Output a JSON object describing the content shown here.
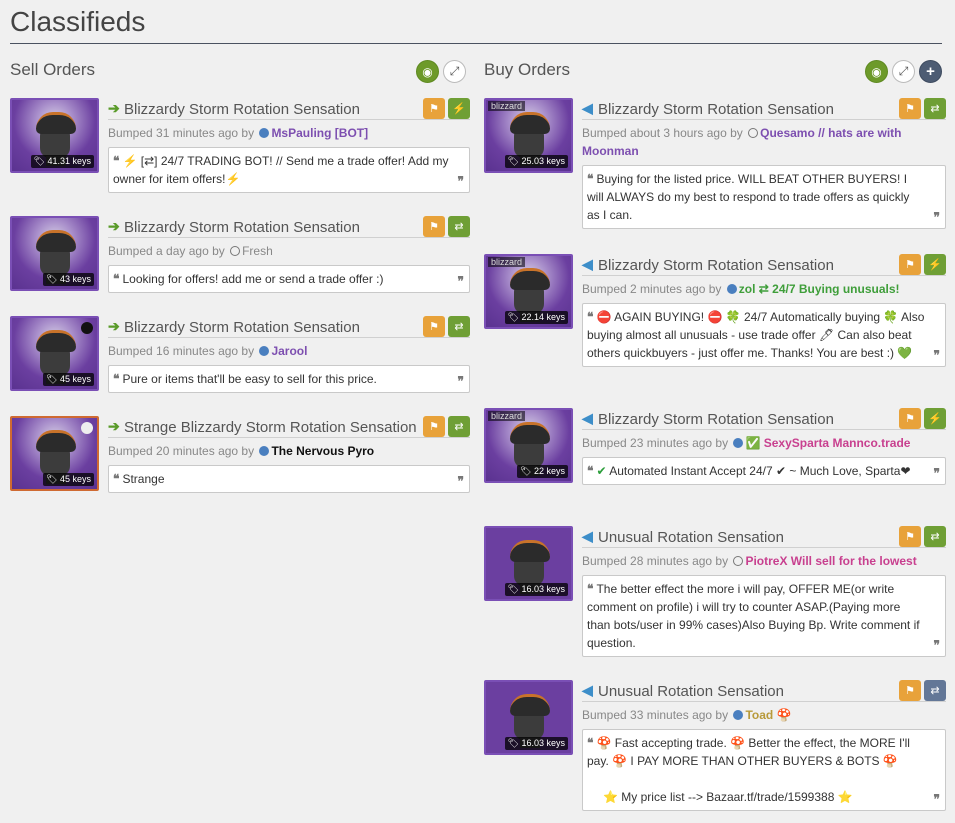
{
  "page": {
    "title": "Classifieds"
  },
  "sell": {
    "title": "Sell Orders",
    "listings": [
      {
        "name": "Blizzardy Storm Rotation Sensation",
        "price": "41.31 keys",
        "bump": "Bumped 31 minutes ago by",
        "user": "MsPauling [BOT]",
        "user_color": "#7d4fb0",
        "dot": "filled",
        "msg_a": "⚡",
        "msg_b": " [⇄] 24/7 TRADING BOT! // Send me a trade offer! Add my owner for item offers!",
        "msg_c": "⚡",
        "btn2": "⚡"
      },
      {
        "name": "Blizzardy Storm Rotation Sensation",
        "price": "43 keys",
        "bump": "Bumped a day ago by",
        "user": "Fresh",
        "user_color": "#888888",
        "dot": "ring",
        "msg_b": "Looking for offers! add me or send a trade offer :)",
        "btn2": "⇄"
      },
      {
        "name": "Blizzardy Storm Rotation Sensation",
        "price": "45 keys",
        "bump": "Bumped 16 minutes ago by",
        "user": "Jarool",
        "user_color": "#7d4fb0",
        "dot": "filled",
        "msg_b": "Pure or items that'll be easy to sell for this price.",
        "btn2": "⇄"
      },
      {
        "name": "Strange Blizzardy Storm Rotation Sensation",
        "price": "45 keys",
        "bump": "Bumped 20 minutes ago by",
        "user": "The Nervous Pyro",
        "user_color": "#111111",
        "dot": "filled",
        "msg_b": "Strange",
        "btn2": "⇄"
      }
    ]
  },
  "buy": {
    "title": "Buy Orders",
    "listings": [
      {
        "name": "Blizzardy Storm Rotation Sensation",
        "price": "25.03 keys",
        "bump": "Bumped about 3 hours ago by",
        "user": "Quesamo // hats are with Moonman",
        "user_color": "#7d4fb0",
        "dot": "ring",
        "msg_b": "Buying for the listed price. WILL BEAT OTHER BUYERS! I will ALWAYS do my best to respond to trade offers as quickly as I can.",
        "btn2": "⇄",
        "label": "blizzard"
      },
      {
        "name": "Blizzardy Storm Rotation Sensation",
        "price": "22.14 keys",
        "bump": "Bumped 2 minutes ago by",
        "user": "zol ⇄ 24/7 Buying unusuals!",
        "user_color": "#3f9e3a",
        "dot": "filled",
        "msg_a": "⛔",
        "msg_b": " AGAIN BUYING! ",
        "msg_c": "⛔ 🍀 24/7 Automatically buying 🍀 Also buying almost all unusuals - use trade offer 🖊 Can also beat others quickbuyers - just offer me. Thanks! You are best :) 💚",
        "btn2": "⚡",
        "label": "blizzard"
      },
      {
        "name": "Blizzardy Storm Rotation Sensation",
        "price": "22 keys",
        "bump": "Bumped 23 minutes ago by",
        "user": "SexySparta Mannco.trade",
        "user_color": "#c8408f",
        "dot": "filled",
        "check": "✅",
        "msg_a": "✔",
        "msg_b": " Automated Instant Accept 24/7 ",
        "msg_c": "✔ ~ Much Love, Sparta❤",
        "btn2": "⚡",
        "label": "blizzard"
      },
      {
        "name": "Unusual Rotation Sensation",
        "price": "16.03 keys",
        "bump": "Bumped 28 minutes ago by",
        "user": "PiotreX Will sell for the lowest",
        "user_color": "#c8408f",
        "dot": "ring",
        "msg_b": "The better effect the more i will pay, OFFER ME(or write comment on profile) i will try to counter ASAP.(Paying more than bots/user in 99% cases)Also Buying Bp. Write comment if question.",
        "btn2": "⇄"
      },
      {
        "name": "Unusual Rotation Sensation",
        "price": "16.03 keys",
        "bump": "Bumped 33 minutes ago by",
        "user": "Toad",
        "user_color": "#b89a3a",
        "dot": "filled",
        "mush": "🍄",
        "msg_a": "🍄",
        "msg_b": " Fast accepting trade. 🍄 Better the effect, the MORE I'll pay. 🍄 I PAY MORE THAN OTHER BUYERS & BOTS 🍄",
        "msg_c": "⭐ My price list --> Bazaar.tf/trade/1599388 ⭐",
        "btn2": "⇄",
        "btn2_color": "slate"
      }
    ]
  },
  "icons": {
    "quote_open": "❝",
    "quote_close": "❞",
    "flag": "⚑",
    "arrow_sell": "➔",
    "arrow_buy": "🡐",
    "eye": "👁",
    "expand": "⤢",
    "plus": "✚"
  }
}
